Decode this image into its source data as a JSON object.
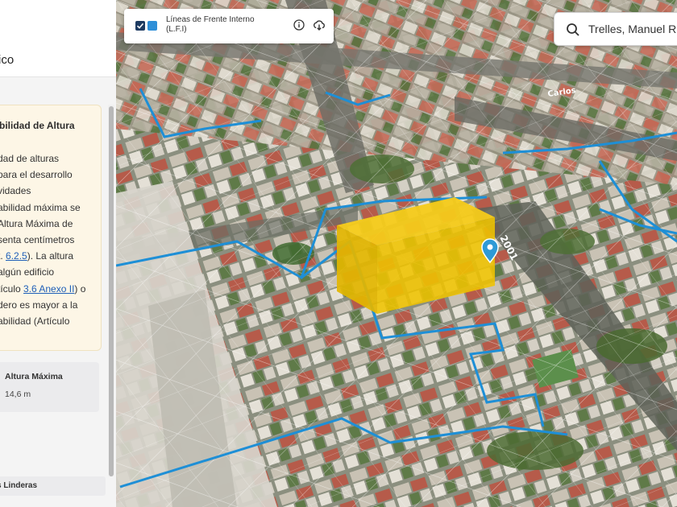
{
  "side_panel": {
    "title": "ico",
    "info_card": {
      "title": "bilidad de Altura",
      "lines": [
        {
          "parts": [
            {
              "text": "dad de alturas"
            }
          ]
        },
        {
          "parts": [
            {
              "text": "para el desarrollo"
            }
          ]
        },
        {
          "parts": [
            {
              "text": "vidades"
            }
          ]
        },
        {
          "parts": [
            {
              "text": "abilidad máxima se"
            }
          ]
        },
        {
          "parts": [
            {
              "text": "Altura Máxima de"
            }
          ]
        },
        {
          "parts": [
            {
              "text": "senta centímetros"
            }
          ]
        },
        {
          "parts": [
            {
              "text": "t. "
            },
            {
              "text": "6.2.5",
              "link": true
            },
            {
              "text": "). La altura"
            }
          ]
        },
        {
          "parts": [
            {
              "text": "algún edificio"
            }
          ]
        },
        {
          "parts": [
            {
              "text": "tículo "
            },
            {
              "text": "3.6 Anexo II",
              "link": true
            },
            {
              "text": ") o"
            }
          ]
        },
        {
          "parts": [
            {
              "text": "dero es mayor a la"
            }
          ]
        },
        {
          "parts": [
            {
              "text": "abilidad (Artículo"
            }
          ]
        }
      ]
    },
    "max_height": {
      "label": "Altura Máxima",
      "value": "14,6 m"
    },
    "linderas_label": "s Linderas"
  },
  "layer_control": {
    "checked": true,
    "name": "Líneas de Frente Interno",
    "abbr": "(L.F.I)",
    "swatch_color": "#2e8fd8",
    "icons": [
      "info-icon",
      "cloud-download-icon"
    ]
  },
  "search": {
    "value": "Trelles, Manuel R.",
    "icon": "search-icon"
  },
  "map": {
    "street_number": "2001",
    "street_label": "Carlos",
    "colors": {
      "frente_interno_line": "#1e8fd6",
      "volume_fill": "#f2c200",
      "marker": "#2e9ad6"
    }
  }
}
